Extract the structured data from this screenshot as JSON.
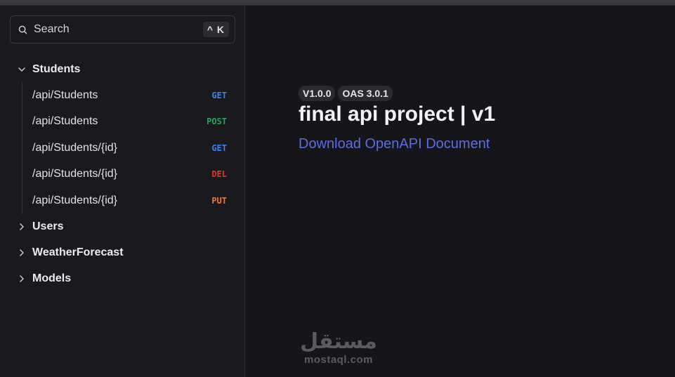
{
  "search": {
    "label": "Search",
    "shortcut": "^ K"
  },
  "sidebar": {
    "groups": [
      {
        "name": "Students",
        "expanded": true,
        "endpoints": [
          {
            "path": "/api/Students",
            "method": "GET",
            "color": "#3b82f6"
          },
          {
            "path": "/api/Students",
            "method": "POST",
            "color": "#22a75e"
          },
          {
            "path": "/api/Students/{id}",
            "method": "GET",
            "color": "#3b82f6"
          },
          {
            "path": "/api/Students/{id}",
            "method": "DEL",
            "color": "#e5312e"
          },
          {
            "path": "/api/Students/{id}",
            "method": "PUT",
            "color": "#f2772b"
          }
        ]
      },
      {
        "name": "Users",
        "expanded": false
      },
      {
        "name": "WeatherForecast",
        "expanded": false
      },
      {
        "name": "Models",
        "expanded": false
      }
    ]
  },
  "main": {
    "version_badge": "V1.0.0",
    "oas_badge": "OAS 3.0.1",
    "title": "final api project | v1",
    "download_link": "Download OpenAPI Document",
    "link_color": "#5b6ee0"
  },
  "watermark": {
    "arabic": "مستقل",
    "latin": "mostaql.com"
  }
}
